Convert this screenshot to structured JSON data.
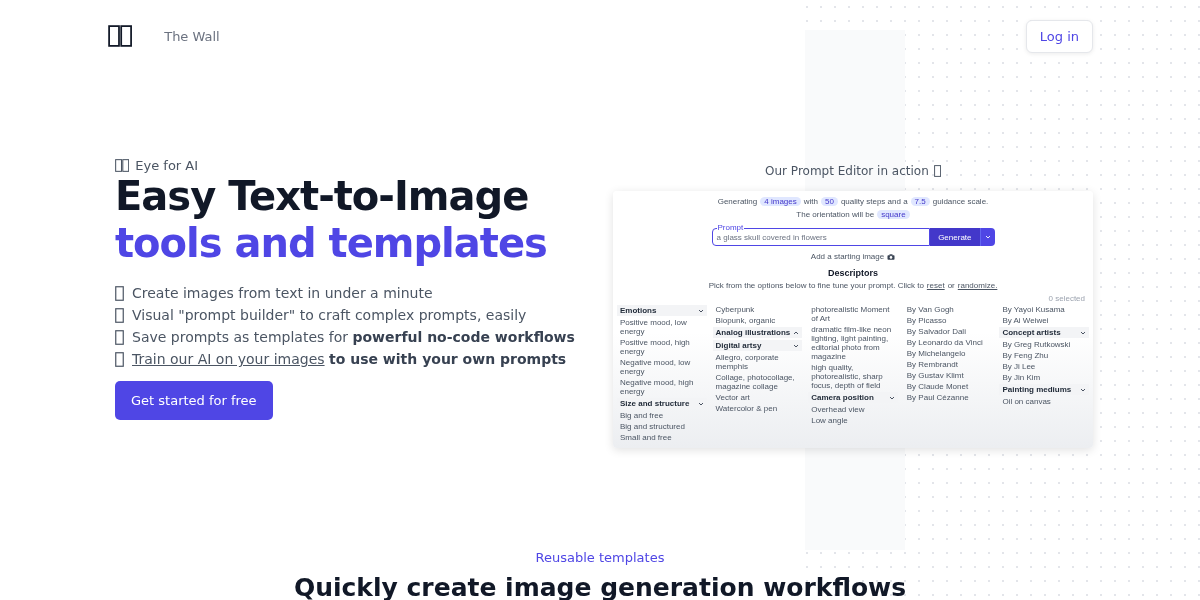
{
  "header": {
    "site_name": "The Wall",
    "login": "Log in"
  },
  "hero": {
    "eyebrow": "Eye for AI",
    "title_line1": "Easy Text-to-Image",
    "title_line2": "tools and templates",
    "features": [
      {
        "text": "Create images from text in under a minute"
      },
      {
        "text": "Visual \"prompt builder\" to craft complex prompts, easily"
      },
      {
        "text": "Save prompts as templates for **powerful no-code workflows**"
      },
      {
        "link": "Train our AI on your images",
        "text": "to use with your own prompts"
      }
    ],
    "cta": "Get started for free"
  },
  "editor": {
    "caption": "Our Prompt Editor in action",
    "settings": [
      [
        {
          "kind": "text",
          "text": "Generating"
        },
        {
          "kind": "chip",
          "text": "4 images"
        },
        {
          "kind": "text",
          "text": "with"
        },
        {
          "kind": "chip",
          "text": "50"
        },
        {
          "kind": "text",
          "text": "quality steps and a"
        },
        {
          "kind": "chip",
          "text": "7.5"
        },
        {
          "kind": "text",
          "text": "guidance scale."
        }
      ],
      [
        {
          "kind": "text",
          "text": "The orientation will be"
        },
        {
          "kind": "chip",
          "text": "square"
        }
      ]
    ],
    "prompt_label": "Prompt",
    "prompt_value": "a glass skull covered in flowers",
    "generate": "Generate",
    "starting_image": "Add a starting image",
    "descriptors_title": "Descriptors",
    "descriptors_hint": [
      {
        "kind": "text",
        "text": "Pick from the options below to fine tune your prompt. Click to"
      },
      {
        "kind": "link",
        "text": "reset"
      },
      {
        "kind": "text",
        "text": "or"
      },
      {
        "kind": "link",
        "text": "randomize."
      }
    ],
    "selected_count": "0 selected",
    "columns": [
      [
        {
          "kind": "heading",
          "text": "Emotions",
          "expanded": true
        },
        {
          "kind": "item",
          "text": "Positive mood, low energy"
        },
        {
          "kind": "item",
          "text": "Positive mood, high energy"
        },
        {
          "kind": "item",
          "text": "Negative mood, low energy"
        },
        {
          "kind": "item",
          "text": "Negative mood, high energy"
        },
        {
          "kind": "heading",
          "text": "Size and structure",
          "expanded": true
        },
        {
          "kind": "item",
          "text": "Big and free"
        },
        {
          "kind": "item",
          "text": "Big and structured"
        },
        {
          "kind": "item",
          "text": "Small and free"
        }
      ],
      [
        {
          "kind": "item",
          "text": "Cyberpunk"
        },
        {
          "kind": "item",
          "text": "Biopunk, organic"
        },
        {
          "kind": "heading",
          "text": "Analog illustrations",
          "expanded": false
        },
        {
          "kind": "heading",
          "text": "Digital artsy",
          "expanded": true
        },
        {
          "kind": "item",
          "text": "Allegro, corporate memphis"
        },
        {
          "kind": "item",
          "text": "Collage, photocollage, magazine collage"
        },
        {
          "kind": "item",
          "text": "Vector art"
        },
        {
          "kind": "item",
          "text": "Watercolor & pen"
        }
      ],
      [
        {
          "kind": "item",
          "text": "photorealistic Moment of Art"
        },
        {
          "kind": "item",
          "text": "dramatic film-like neon lighting, light painting, editorial photo from magazine"
        },
        {
          "kind": "item",
          "text": "high quality, photorealistic, sharp focus, depth of field"
        },
        {
          "kind": "heading",
          "text": "Camera position",
          "expanded": true
        },
        {
          "kind": "item",
          "text": "Overhead view"
        },
        {
          "kind": "item",
          "text": "Low angle"
        }
      ],
      [
        {
          "kind": "item",
          "text": "By Van Gogh"
        },
        {
          "kind": "item",
          "text": "By Picasso"
        },
        {
          "kind": "item",
          "text": "By Salvador Dali"
        },
        {
          "kind": "item",
          "text": "By Leonardo da Vinci"
        },
        {
          "kind": "item",
          "text": "By Michelangelo"
        },
        {
          "kind": "item",
          "text": "By Rembrandt"
        },
        {
          "kind": "item",
          "text": "By Gustav Klimt"
        },
        {
          "kind": "item",
          "text": "By Claude Monet"
        },
        {
          "kind": "item",
          "text": "By Paul Cézanne"
        }
      ],
      [
        {
          "kind": "item",
          "text": "By Yayoi Kusama"
        },
        {
          "kind": "item",
          "text": "By Ai Weiwei"
        },
        {
          "kind": "heading",
          "text": "Concept artists",
          "expanded": true
        },
        {
          "kind": "item",
          "text": "By Greg Rutkowski"
        },
        {
          "kind": "item",
          "text": "By Feng Zhu"
        },
        {
          "kind": "item",
          "text": "By Ji Lee"
        },
        {
          "kind": "item",
          "text": "By Jin Kim"
        },
        {
          "kind": "heading",
          "text": "Painting mediums",
          "expanded": true
        },
        {
          "kind": "item",
          "text": "Oil on canvas"
        }
      ]
    ]
  },
  "templates": {
    "eyebrow": "Reusable templates",
    "title": "Quickly create image generation workflows"
  }
}
